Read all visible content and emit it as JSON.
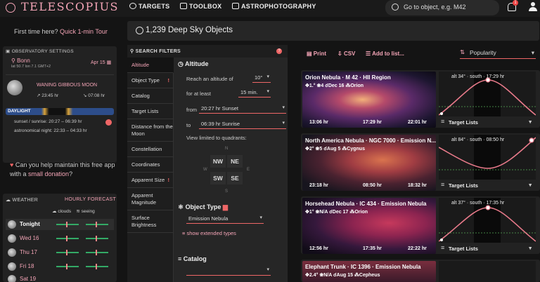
{
  "topbar": {
    "logo": "TELESCOPIUS",
    "nav": [
      "TARGETS",
      "TOOLBOX",
      "ASTROPHOTOGRAPHY"
    ],
    "search_placeholder": "Go to object, e.g. M42",
    "notif_count": "1"
  },
  "left": {
    "first_time": "First time here?",
    "tour_link": "Quick 1-min Tour",
    "obs_title": "OBSERVATORY SETTINGS",
    "location": "Bonn",
    "coords": "lat 50.7  lon 7.1  GMT+2",
    "date": "Apr 15",
    "moon_phase": "WANING GIBBOUS MOON",
    "moonrise": "23:45 hr",
    "moonset": "07:08 hr",
    "daylight": "DAYLIGHT",
    "sun": "sunset / sunrise: 20:27 – 06:39 hr",
    "astro": "astronomical night: 22:33 – 04:33 hr",
    "donate_q": "Can you help maintain this free app with a",
    "donate_link": "small donation",
    "donate_end": "?",
    "weather_title": "WEATHER",
    "forecast_link": "HOURLY FORECAST",
    "clouds": "clouds",
    "seeing": "seeing",
    "days": [
      "Tonight",
      "Wed 16",
      "Thu 17",
      "Fri 18",
      "Sat 19"
    ]
  },
  "center": {
    "title": "1,239 Deep Sky Objects"
  },
  "filters": {
    "head": "SEARCH FILTERS",
    "tabs": [
      "Altitude",
      "Object Type",
      "Catalog",
      "Target Lists",
      "Distance from the Moon",
      "Constellation",
      "Coordinates",
      "Apparent Size",
      "Apparent Magnitude",
      "Surface Brightness"
    ],
    "alt_title": "Altitude",
    "reach": "Reach an altitude of",
    "reach_val": "10°",
    "atleast": "for at least",
    "atleast_val": "15 min.",
    "from": "from",
    "from_val": "20:27 hr Sunset",
    "to": "to",
    "to_val": "06:39 hr Sunrise",
    "quadrants": "View limited to quadrants:",
    "quad": [
      "NW",
      "NE",
      "SW",
      "SE"
    ],
    "dirs": [
      "N",
      "E",
      "S",
      "W"
    ],
    "type_title": "Object Type",
    "type_val": "Emission Nebula",
    "ext_link": "show extended types",
    "cat_title": "Catalog",
    "cat_val": ""
  },
  "list": {
    "toolbar": [
      "Print",
      "CSV",
      "Add to list..."
    ],
    "sort": "Popularity",
    "target_lists": "Target Lists",
    "cards": [
      {
        "title": "Orion Nebula · M 42 · HII Region",
        "meta": "✥1.°   ❀4   ☌Dec 16   ⁂Orion",
        "rise": "13:06 hr",
        "transit": "17:29 hr",
        "set": "22:01 hr",
        "chart": "alt 34° · south · 17:29 hr"
      },
      {
        "title": "North America Nebula · NGC 7000 · Emission N...",
        "meta": "✥2°   ❀5   ☌Aug 5   ⁂Cygnus",
        "rise": "23:18 hr",
        "transit": "08:50 hr",
        "set": "18:32 hr",
        "chart": "alt 84° · south · 08:50 hr"
      },
      {
        "title": "Horsehead Nebula · IC 434 · Emission Nebula",
        "meta": "✥1°   ❀N/A   ☌Dec 17   ⁂Orion",
        "rise": "12:56 hr",
        "transit": "17:35 hr",
        "set": "22:22 hr",
        "chart": "alt 37° · south · 17:35 hr"
      },
      {
        "title": "Elephant Trunk · IC 1396 · Emission Nebula",
        "meta": "✥2.4°   ❀N/A   ☌Aug 15   ⁂Cepheus",
        "rise": "",
        "transit": "",
        "set": "",
        "chart": ""
      }
    ]
  }
}
